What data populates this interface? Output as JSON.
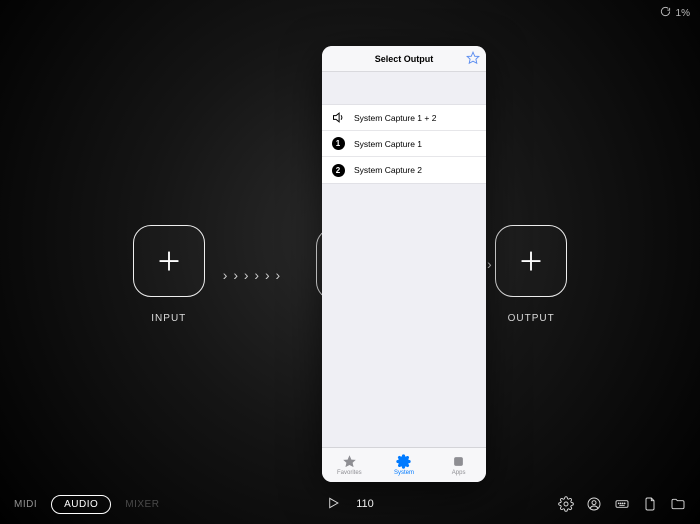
{
  "status": {
    "battery_pct": "1%"
  },
  "nodes": {
    "input_label": "INPUT",
    "output_label": "OUTPUT"
  },
  "arrows_glyph_seq": "› › › › › ›",
  "bottom": {
    "midi": "MIDI",
    "audio": "AUDIO",
    "mixer": "MIXER",
    "tempo": "110"
  },
  "popup": {
    "title": "Select Output",
    "items": [
      {
        "icon": "speaker",
        "label": "System Capture 1 + 2"
      },
      {
        "icon": "num1",
        "label": "System Capture 1"
      },
      {
        "icon": "num2",
        "label": "System Capture 2"
      }
    ],
    "tabs": {
      "favorites": "Favorites",
      "system": "System",
      "apps": "Apps"
    }
  },
  "icons": {
    "num1": "1",
    "num2": "2"
  }
}
